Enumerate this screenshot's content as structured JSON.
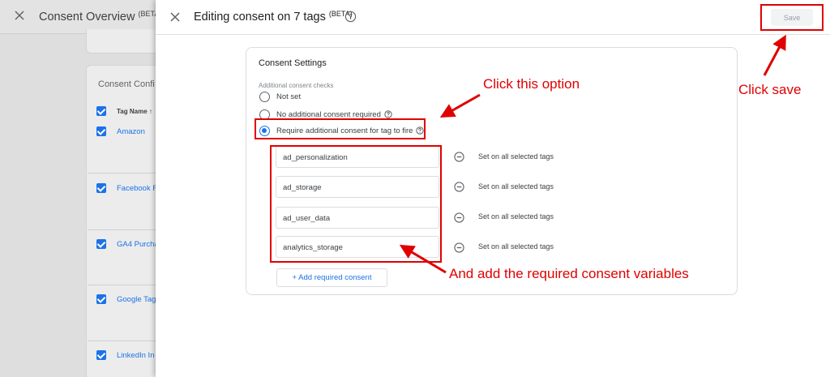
{
  "background": {
    "title": "Consent Overview",
    "title_badge": "(BETA)",
    "card_title": "Consent Confi",
    "tag_column_header": "Tag Name ↑",
    "tags": [
      "Amazon",
      "Facebook F",
      "GA4 Purcha",
      "Google Tag",
      "LinkedIn In"
    ]
  },
  "dialog": {
    "title": "Editing consent on 7 tags",
    "title_badge": "(BETA)",
    "save_label": "Save"
  },
  "consent_settings": {
    "title": "Consent Settings",
    "checks_label": "Additional consent checks",
    "options": [
      {
        "label": "Not set",
        "selected": false
      },
      {
        "label": "No additional consent required",
        "selected": false
      },
      {
        "label": "Require additional consent for tag to fire",
        "selected": true
      }
    ],
    "variables": [
      {
        "name": "ad_personalization",
        "status": "Set on all selected tags"
      },
      {
        "name": "ad_storage",
        "status": "Set on all selected tags"
      },
      {
        "name": "ad_user_data",
        "status": "Set on all selected tags"
      },
      {
        "name": "analytics_storage",
        "status": "Set on all selected tags"
      }
    ],
    "add_button_label": "+ Add required consent"
  },
  "annotations": {
    "click_option": "Click this option",
    "click_save": "Click save",
    "add_variables": "And add the required consent variables",
    "color": "#e00000"
  },
  "colors": {
    "accent": "#1a73e8",
    "annotation": "#e00000"
  }
}
